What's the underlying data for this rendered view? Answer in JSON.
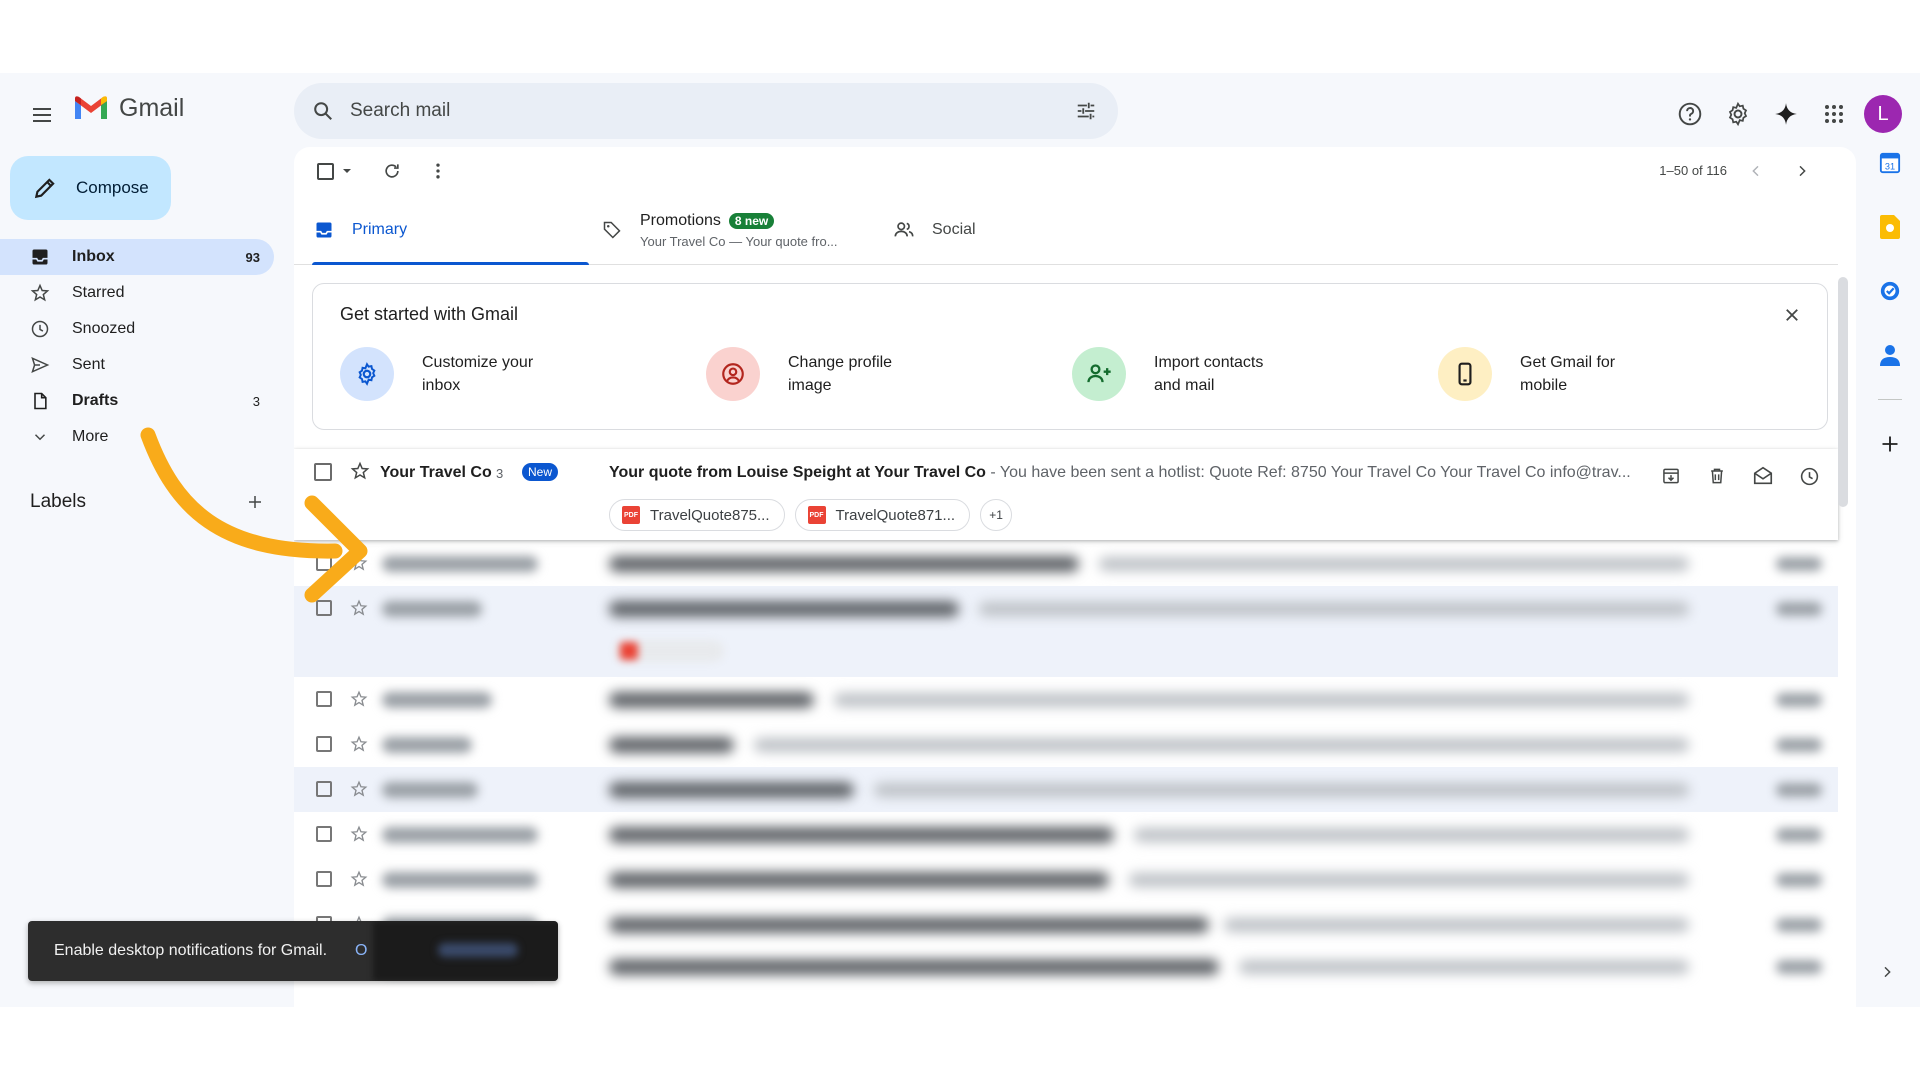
{
  "app": {
    "name": "Gmail",
    "avatar_letter": "L"
  },
  "search": {
    "placeholder": "Search mail"
  },
  "compose": {
    "label": "Compose"
  },
  "nav": [
    {
      "label": "Inbox",
      "count": "93",
      "icon": "inbox-icon",
      "active": true
    },
    {
      "label": "Starred",
      "count": "",
      "icon": "star-icon"
    },
    {
      "label": "Snoozed",
      "count": "",
      "icon": "clock-icon"
    },
    {
      "label": "Sent",
      "count": "",
      "icon": "send-icon"
    },
    {
      "label": "Drafts",
      "count": "3",
      "icon": "draft-icon",
      "bold": true
    },
    {
      "label": "More",
      "count": "",
      "icon": "chevron-down-icon"
    }
  ],
  "labels": {
    "title": "Labels"
  },
  "toolbar": {
    "pager": "1–50 of 116"
  },
  "tabs": {
    "primary": "Primary",
    "promotions": "Promotions",
    "promotions_badge": "8 new",
    "promotions_snippet": "Your Travel Co — Your quote fro...",
    "social": "Social"
  },
  "get_started": {
    "title": "Get started with Gmail",
    "items": [
      {
        "line1": "Customize your",
        "line2": "inbox"
      },
      {
        "line1": "Change profile",
        "line2": "image"
      },
      {
        "line1": "Import contacts",
        "line2": "and mail"
      },
      {
        "line1": "Get Gmail for",
        "line2": "mobile"
      }
    ]
  },
  "highlighted_email": {
    "sender": "Your Travel Co",
    "count": "3",
    "badge": "New",
    "subject": "Your quote from Louise Speight at Your Travel Co",
    "snippet": " - You have been sent a hotlist: Quote Ref: 8750 Your Travel Co Your Travel Co info@trav...",
    "attachments": [
      "TravelQuote875...",
      "TravelQuote871..."
    ],
    "more_attachments": "+1"
  },
  "toast": {
    "message": "Enable desktop notifications for Gmail.",
    "action": "O"
  },
  "colors": {
    "accent": "#0b57d0",
    "compose_bg": "#c2e7ff",
    "active_nav": "#d3e3fd",
    "annotation_arrow": "#f9ab1a"
  }
}
